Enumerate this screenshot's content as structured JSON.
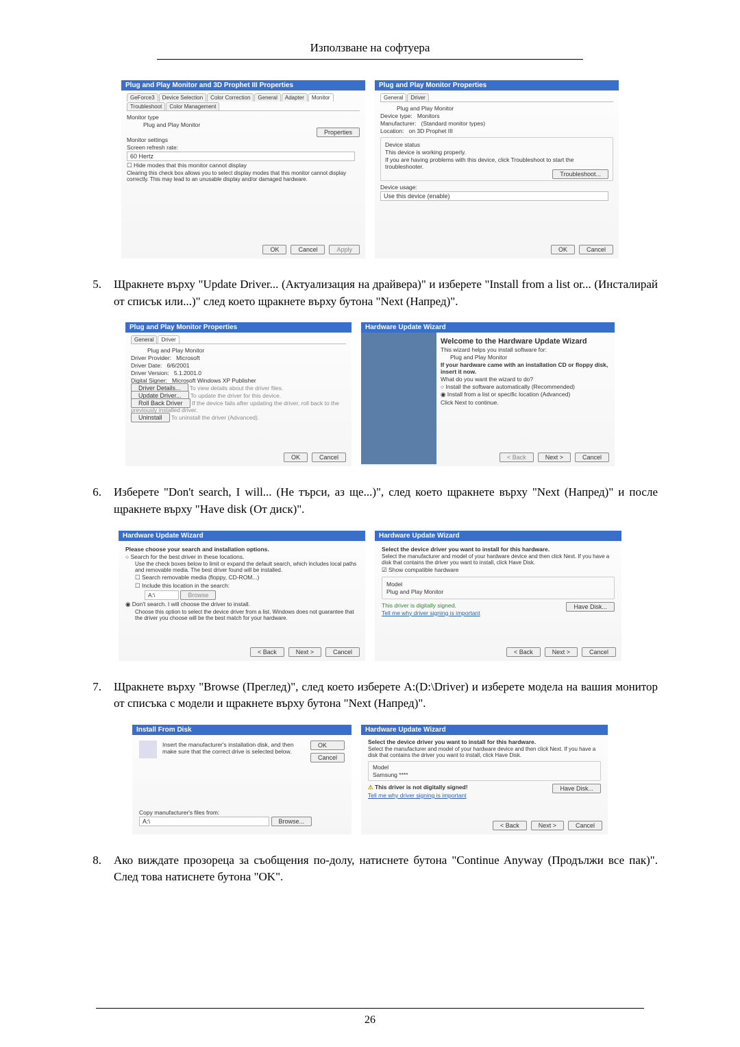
{
  "header": "Използване на софтуера",
  "page_number": "26",
  "steps": {
    "s5": {
      "num": "5.",
      "text": "Щракнете върху \"Update Driver... (Актуализация на драйвера)\" и изберете \"Install from a list or... (Инсталирай от списък или...)\" след което щракнете върху бутона \"Next (Напред)\"."
    },
    "s6": {
      "num": "6.",
      "text": "Изберете \"Don't search, I will... (Не търси, аз ще...)\", след което щракнете върху \"Next (Напред)\" и после щракнете върху \"Have disk (От диск)\"."
    },
    "s7": {
      "num": "7.",
      "text": "Щракнете върху \"Browse (Преглед)\", след което изберете A:(D:\\Driver) и изберете модела на вашия монитор от списъка с модели и щракнете върху бутона \"Next (Напред)\"."
    },
    "s8": {
      "num": "8.",
      "text": "Ако виждате прозореца за съобщения по-долу, натиснете бутона \"Continue Anyway (Продължи все пак)\". След това натиснете бутона \"OK\"."
    }
  },
  "dialogs": {
    "d1a": {
      "title": "Plug and Play Monitor and 3D Prophet III Properties",
      "tabs": [
        "GeForce3",
        "Device Selection",
        "Color Correction",
        "General",
        "Adapter",
        "Monitor",
        "Troubleshoot",
        "Color Management"
      ],
      "monitor_type_label": "Monitor type",
      "monitor_type_value": "Plug and Play Monitor",
      "properties_btn": "Properties",
      "monitor_settings_label": "Monitor settings",
      "refresh_label": "Screen refresh rate:",
      "refresh_value": "60 Hertz",
      "hide_modes": "Hide modes that this monitor cannot display",
      "hide_modes_desc": "Clearing this check box allows you to select display modes that this monitor cannot display correctly. This may lead to an unusable display and/or damaged hardware.",
      "ok": "OK",
      "cancel": "Cancel",
      "apply": "Apply"
    },
    "d1b": {
      "title": "Plug and Play Monitor Properties",
      "tabs": [
        "General",
        "Driver"
      ],
      "heading": "Plug and Play Monitor",
      "rows": {
        "devtype_l": "Device type:",
        "devtype_v": "Monitors",
        "manu_l": "Manufacturer:",
        "manu_v": "(Standard monitor types)",
        "loc_l": "Location:",
        "loc_v": "on 3D Prophet III"
      },
      "status_label": "Device status",
      "status_line": "This device is working properly.",
      "status_help": "If you are having problems with this device, click Troubleshoot to start the troubleshooter.",
      "tshoot": "Troubleshoot...",
      "usage_label": "Device usage:",
      "usage_value": "Use this device (enable)",
      "ok": "OK",
      "cancel": "Cancel"
    },
    "d2a": {
      "title": "Plug and Play Monitor Properties",
      "tabs": [
        "General",
        "Driver"
      ],
      "heading": "Plug and Play Monitor",
      "rows": {
        "prov_l": "Driver Provider:",
        "prov_v": "Microsoft",
        "date_l": "Driver Date:",
        "date_v": "6/6/2001",
        "ver_l": "Driver Version:",
        "ver_v": "5.1.2001.0",
        "sign_l": "Digital Signer:",
        "sign_v": "Microsoft Windows XP Publisher"
      },
      "btns": {
        "details": "Driver Details...",
        "details_d": "To view details about the driver files.",
        "update": "Update Driver...",
        "update_d": "To update the driver for this device.",
        "rollback": "Roll Back Driver",
        "rollback_d": "If the device fails after updating the driver, roll back to the previously installed driver.",
        "uninstall": "Uninstall",
        "uninstall_d": "To uninstall the driver (Advanced)."
      },
      "ok": "OK",
      "cancel": "Cancel"
    },
    "d2b": {
      "title": "Hardware Update Wizard",
      "welcome": "Welcome to the Hardware Update Wizard",
      "helps": "This wizard helps you install software for:",
      "device": "Plug and Play Monitor",
      "cd_hint": "If your hardware came with an installation CD or floppy disk, insert it now.",
      "what": "What do you want the wizard to do?",
      "opt1": "Install the software automatically (Recommended)",
      "opt2": "Install from a list or specific location (Advanced)",
      "cont": "Click Next to continue.",
      "back": "< Back",
      "next": "Next >",
      "cancel": "Cancel"
    },
    "d3a": {
      "title": "Hardware Update Wizard",
      "heading": "Please choose your search and installation options.",
      "opt1": "Search for the best driver in these locations.",
      "opt1_desc": "Use the check boxes below to limit or expand the default search, which includes local paths and removable media. The best driver found will be installed.",
      "chk1": "Search removable media (floppy, CD-ROM...)",
      "chk2": "Include this location in the search:",
      "path": "A:\\",
      "browse": "Browse",
      "opt2": "Don't search. I will choose the driver to install.",
      "opt2_desc": "Choose this option to select the device driver from a list. Windows does not guarantee that the driver you choose will be the best match for your hardware.",
      "back": "< Back",
      "next": "Next >",
      "cancel": "Cancel"
    },
    "d3b": {
      "title": "Hardware Update Wizard",
      "heading": "Select the device driver you want to install for this hardware.",
      "desc": "Select the manufacturer and model of your hardware device and then click Next. If you have a disk that contains the driver you want to install, click Have Disk.",
      "show_compat": "Show compatible hardware",
      "model_label": "Model",
      "model_value": "Plug and Play Monitor",
      "signed": "This driver is digitally signed.",
      "tellme": "Tell me why driver signing is important",
      "havedisk": "Have Disk...",
      "back": "< Back",
      "next": "Next >",
      "cancel": "Cancel"
    },
    "d4a": {
      "title": "Install From Disk",
      "text": "Insert the manufacturer's installation disk, and then make sure that the correct drive is selected below.",
      "ok": "OK",
      "cancel": "Cancel",
      "copy_label": "Copy manufacturer's files from:",
      "path": "A:\\",
      "browse": "Browse..."
    },
    "d4b": {
      "title": "Hardware Update Wizard",
      "heading": "Select the device driver you want to install for this hardware.",
      "desc": "Select the manufacturer and model of your hardware device and then click Next. If you have a disk that contains the driver you want to install, click Have Disk.",
      "model_label": "Model",
      "model_value": "Samsung ****",
      "unsigned": "This driver is not digitally signed!",
      "tellme": "Tell me why driver signing is important",
      "havedisk": "Have Disk...",
      "back": "< Back",
      "next": "Next >",
      "cancel": "Cancel"
    }
  }
}
